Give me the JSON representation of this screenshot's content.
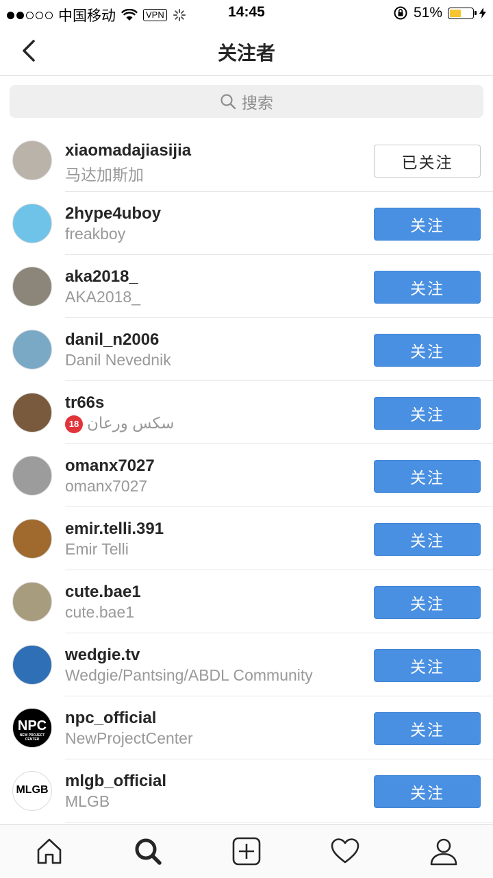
{
  "status_bar": {
    "carrier": "中国移动",
    "vpn": "VPN",
    "time": "14:45",
    "battery": "51%",
    "battery_level": 0.51
  },
  "header": {
    "title": "关注者",
    "back_icon": "chevron-left-icon"
  },
  "search": {
    "placeholder": "搜索",
    "icon": "search-icon"
  },
  "users": [
    {
      "username": "xiaomadajiasijia",
      "fullname": "马达加斯加",
      "button": "已关注",
      "following": true,
      "avatar_color": "#b9b3a9"
    },
    {
      "username": "2hype4uboy",
      "fullname": "freakboy",
      "button": "关注",
      "following": false,
      "avatar_color": "#6fc3e8"
    },
    {
      "username": "aka2018_",
      "fullname": "AKA2018_",
      "button": "关注",
      "following": false,
      "avatar_color": "#8c8579"
    },
    {
      "username": "danil_n2006",
      "fullname": "Danil Nevednik",
      "button": "关注",
      "following": false,
      "avatar_color": "#7aa9c6"
    },
    {
      "username": "tr66s",
      "fullname": "سکس ورعان",
      "age_badge": "18",
      "button": "关注",
      "following": false,
      "avatar_color": "#7a5a3c"
    },
    {
      "username": "omanx7027",
      "fullname": "omanx7027",
      "button": "关注",
      "following": false,
      "avatar_color": "#9c9c9c"
    },
    {
      "username": "emir.telli.391",
      "fullname": "Emir Telli",
      "button": "关注",
      "following": false,
      "avatar_color": "#a0692e"
    },
    {
      "username": "cute.bae1",
      "fullname": "cute.bae1",
      "button": "关注",
      "following": false,
      "avatar_color": "#a89c7e"
    },
    {
      "username": "wedgie.tv",
      "fullname": "Wedgie/Pantsing/ABDL Community",
      "button": "关注",
      "following": false,
      "avatar_color": "#2f6fb5"
    },
    {
      "username": "npc_official",
      "fullname": "NewProjectCenter",
      "button": "关注",
      "following": false,
      "avatar_color": "#000000",
      "avatar_text": "NPC",
      "avatar_subtext": "NEW PROJECT CENTER"
    },
    {
      "username": "mlgb_official",
      "fullname": "MLGB",
      "button": "关注",
      "following": false,
      "avatar_color": "#ffffff",
      "avatar_text": "MLGB"
    }
  ],
  "tabs": [
    {
      "name": "home",
      "icon": "home-icon"
    },
    {
      "name": "search",
      "icon": "search-icon",
      "active": true
    },
    {
      "name": "add",
      "icon": "add-post-icon"
    },
    {
      "name": "activity",
      "icon": "heart-icon"
    },
    {
      "name": "profile",
      "icon": "profile-icon"
    }
  ],
  "colors": {
    "follow_blue": "#4a90e2",
    "separator": "#dbdbdb",
    "secondary_text": "#999999"
  }
}
